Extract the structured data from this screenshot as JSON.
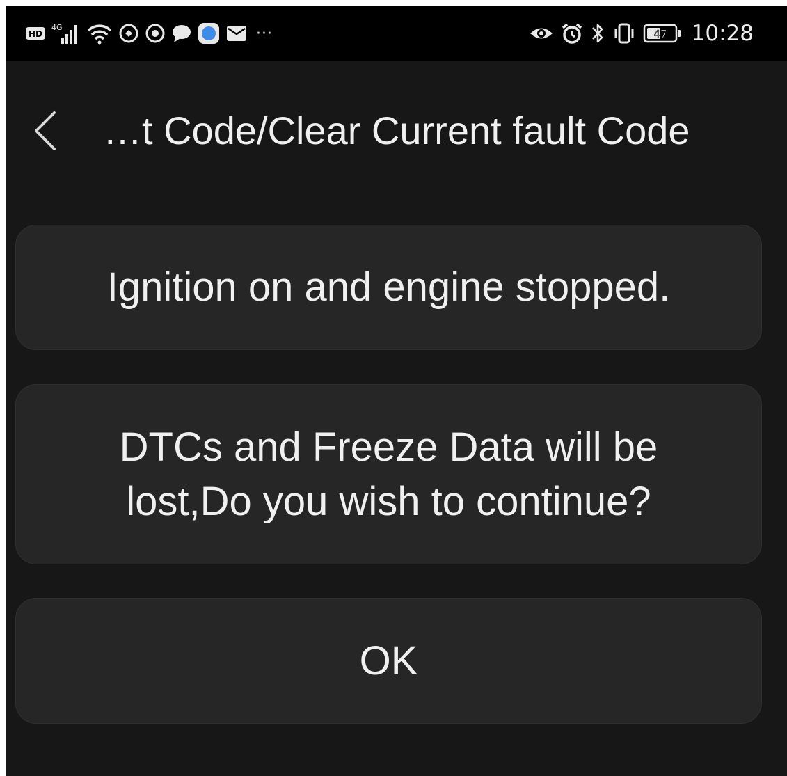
{
  "status_bar": {
    "left_icons": [
      "hd-icon",
      "signal-icon",
      "wifi-icon",
      "vpn-icon",
      "app-icon",
      "chat-icon",
      "browser-icon",
      "mail-icon"
    ],
    "overflow": "···",
    "right_icons": [
      "eye-icon",
      "alarm-icon",
      "bluetooth-icon",
      "vibrate-icon"
    ],
    "battery_level": "47",
    "time": "10:28",
    "network_label": "4G"
  },
  "app_bar": {
    "title": "…t Code/Clear Current fault Code"
  },
  "cards": {
    "ignition_text": "Ignition on and engine stopped.",
    "warning_line1": "DTCs and Freeze Data will be",
    "warning_line2": "lost,Do you wish to continue?",
    "ok_label": "OK"
  },
  "colors": {
    "background": "#171717",
    "card": "#262626",
    "status_bar": "#000000",
    "text": "#f0f0f0",
    "browser_icon": "#3f8be8"
  }
}
